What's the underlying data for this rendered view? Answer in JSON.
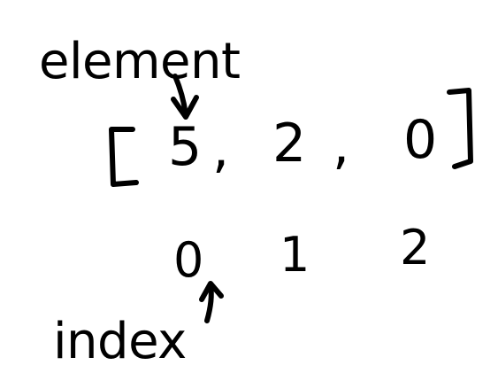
{
  "labels": {
    "element": "element",
    "index": "index"
  },
  "array": {
    "open_bracket": "[",
    "close_bracket": "]",
    "separator": ",",
    "elements": [
      "5",
      "2",
      "0"
    ],
    "indices": [
      "0",
      "1",
      "2"
    ]
  },
  "colors": {
    "ink": "#000000",
    "background": "#ffffff"
  }
}
